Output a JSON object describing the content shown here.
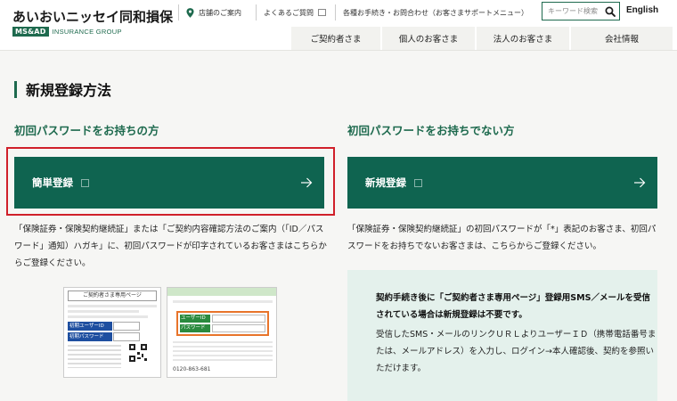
{
  "header": {
    "company_name": "あいおいニッセイ同和損保",
    "group_badge": "MS&AD",
    "group_name": "INSURANCE GROUP",
    "util_links": [
      "店舗のご案内",
      "よくあるご質問",
      "各種お手続き・お問合わせ（お客さまサポートメニュー）"
    ],
    "search_placeholder": "キーワード検索",
    "english_label": "English",
    "nav": [
      "ご契約者さま",
      "個人のお客さま",
      "法人のお客さま",
      "会社情報"
    ]
  },
  "page": {
    "title": "新規登録方法",
    "left": {
      "heading": "初回パスワードをお持ちの方",
      "button_label": "簡単登録",
      "description": "「保険証券・保険契約継続証」または「ご契約内容確認方法のご案内（「ID／パスワード」通知）ハガキ」に、初回パスワードが印字されているお客さまはこちらからご登録ください。",
      "card_a": {
        "title": "ご契約者さま専用ページ",
        "id_label": "初期ユーザーID",
        "pw_label": "初期パスワード"
      },
      "card_b": {
        "field_a": "ユーザーID",
        "field_b": "パスワード",
        "phone": "0120-863-681"
      }
    },
    "right": {
      "heading": "初回パスワードをお持ちでない方",
      "button_label": "新規登録",
      "description": "「保険証券・保険契約継続証」の初回パスワードが「*」表記のお客さま、初回パスワードをお持ちでないお客さまは、こちらからご登録ください。",
      "info_bold": "契約手続き後に「ご契約者さま専用ページ」登録用SMS／メールを受信されている場合は新規登録は不要です。",
      "info_text": "受信したSMS・メールのリンクＵＲＬよりユーザーＩＤ（携帯電話番号または、メールアドレス）を入力し、ログイン→本人確認後、契約を参照いただけます。"
    }
  },
  "colors": {
    "brand_green": "#1e6a4e",
    "button_green": "#0f6450",
    "highlight_red": "#d0202a",
    "info_bg": "#e4f1ec"
  }
}
